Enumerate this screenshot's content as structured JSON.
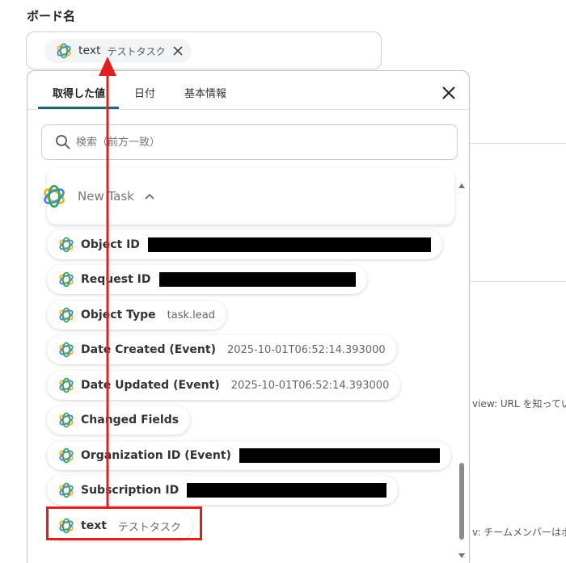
{
  "board": {
    "label": "ボード名"
  },
  "chip": {
    "name": "text",
    "value": "テストタスク"
  },
  "tabs": [
    {
      "label": "取得した値"
    },
    {
      "label": "日付"
    },
    {
      "label": "基本情報"
    }
  ],
  "search": {
    "placeholder": "検索（前方一致）"
  },
  "group": {
    "name": "New Task"
  },
  "items": [
    {
      "name": "Object ID",
      "value": ""
    },
    {
      "name": "Request ID",
      "value": ""
    },
    {
      "name": "Object Type",
      "value": "task.lead"
    },
    {
      "name": "Date Created (Event)",
      "value": "2025-10-01T06:52:14.393000"
    },
    {
      "name": "Date Updated (Event)",
      "value": "2025-10-01T06:52:14.393000"
    },
    {
      "name": "Changed Fields",
      "value": ""
    },
    {
      "name": "Organization ID (Event)",
      "value": ""
    },
    {
      "name": "Subscription ID",
      "value": ""
    },
    {
      "name": "text",
      "value": "テストタスク"
    }
  ],
  "background": {
    "text1": "view: URL を知ってい",
    "text2": "v: チームメンバーはボ"
  },
  "colors": {
    "accent": "#1c6a78",
    "highlight": "#e02020"
  },
  "icons": {
    "field": "asana-logo-icon",
    "close": "close-icon",
    "search": "search-icon",
    "collapse": "chevron-up-icon"
  }
}
